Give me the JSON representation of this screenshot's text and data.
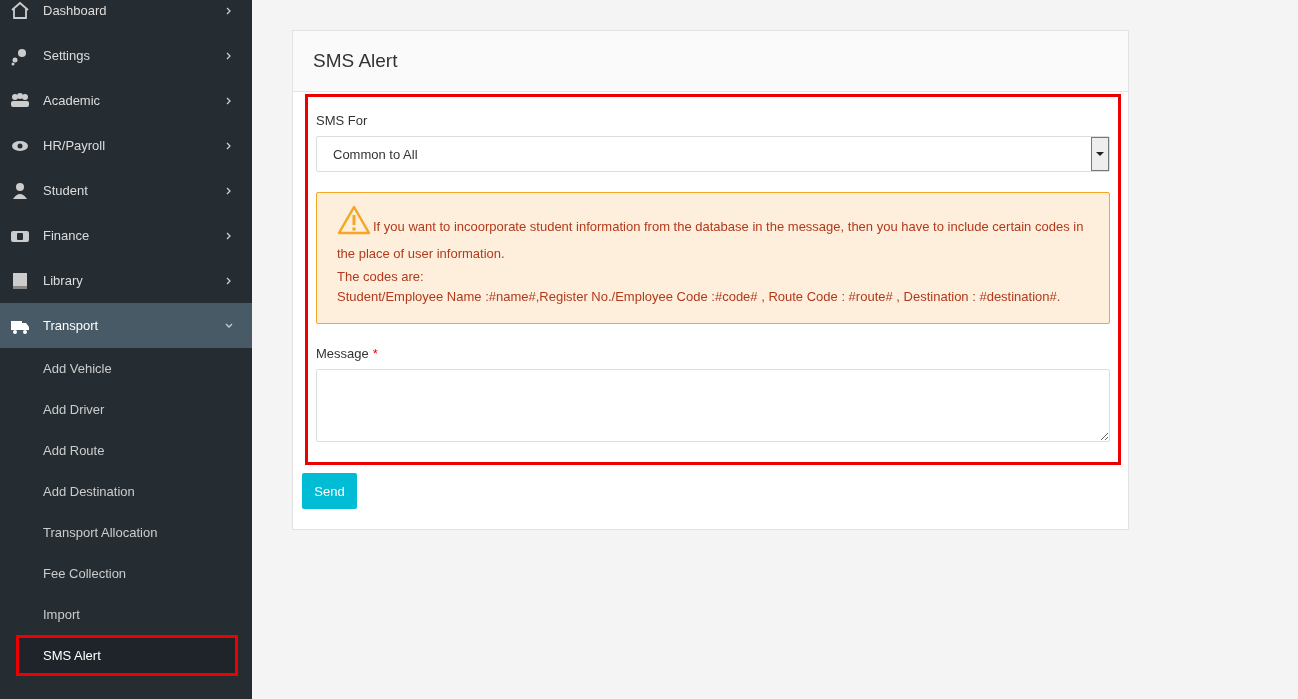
{
  "sidebar": {
    "items": [
      {
        "label": "Dashboard",
        "expanded": false
      },
      {
        "label": "Settings",
        "expanded": false
      },
      {
        "label": "Academic",
        "expanded": false
      },
      {
        "label": "HR/Payroll",
        "expanded": false
      },
      {
        "label": "Student",
        "expanded": false
      },
      {
        "label": "Finance",
        "expanded": false
      },
      {
        "label": "Library",
        "expanded": false
      },
      {
        "label": "Transport",
        "expanded": true,
        "children": [
          {
            "label": "Add Vehicle",
            "selected": false
          },
          {
            "label": "Add Driver",
            "selected": false
          },
          {
            "label": "Add Route",
            "selected": false
          },
          {
            "label": "Add Destination",
            "selected": false
          },
          {
            "label": "Transport Allocation",
            "selected": false
          },
          {
            "label": "Fee Collection",
            "selected": false
          },
          {
            "label": "Import",
            "selected": false
          },
          {
            "label": "SMS Alert",
            "selected": true
          }
        ]
      }
    ]
  },
  "card": {
    "title": "SMS Alert",
    "highlighted": true,
    "sms_for": {
      "label": "SMS For",
      "value": "Common to All"
    },
    "alert": {
      "lines": [
        "If you want to incoorporate student information from the database in the message, then you have to include certain codes in the place of user information.",
        "The codes are:",
        "Student/Employee Name :#name#,Register No./Employee Code :#code# , Route Code : #route# , Destination : #destination#."
      ]
    },
    "message": {
      "label": "Message",
      "required_mark": "*"
    },
    "button": "Send"
  }
}
